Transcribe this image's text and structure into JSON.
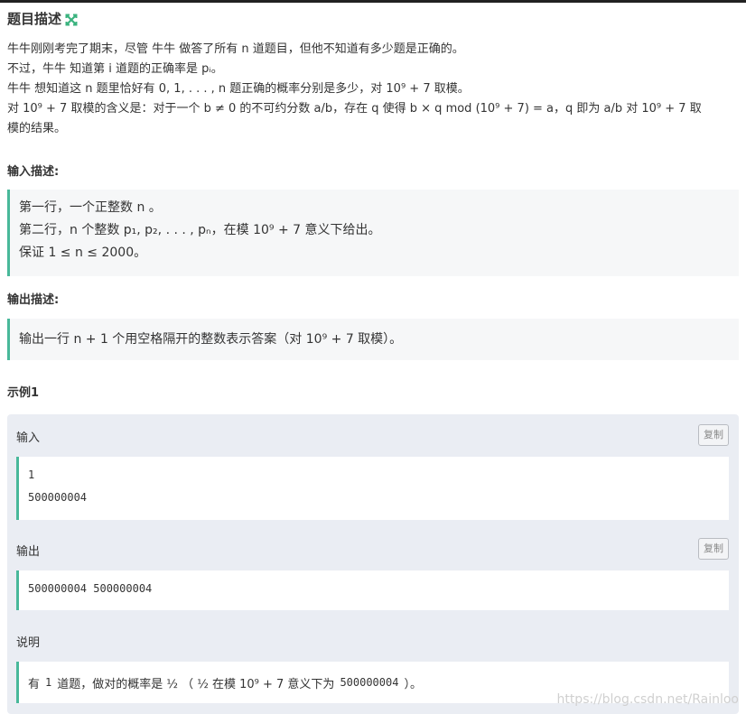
{
  "header": {
    "title": "题目描述",
    "expand_icon": "expand-arrows-icon",
    "accent": "#3bb37f"
  },
  "description": {
    "l1": "牛牛刚刚考完了期末，尽管 牛牛 做答了所有 n 道题目，但他不知道有多少题是正确的。",
    "l2": "不过，牛牛 知道第 i 道题的正确率是 pᵢ。",
    "l3": "牛牛 想知道这 n 题里恰好有 0, 1, . . . , n 题正确的概率分别是多少，对 10⁹ + 7 取模。",
    "l4": "对 10⁹ + 7 取模的含义是：对于一个 b ≠ 0 的不可约分数 a/b，存在 q 使得 b × q mod (10⁹ + 7) = a，q 即为 a/b 对 10⁹ + 7 取",
    "l5": "模的结果。"
  },
  "input_section": {
    "heading": "输入描述:",
    "l1": "第一行，一个正整数 n 。",
    "l2": "第二行，n 个整数 p₁, p₂, . . . , pₙ，在模 10⁹ + 7 意义下给出。",
    "l3": "保证 1 ≤ n ≤ 2000。"
  },
  "output_section": {
    "heading": "输出描述:",
    "l1": "输出一行 n + 1 个用空格隔开的整数表示答案（对 10⁹ + 7 取模）。"
  },
  "example": {
    "heading": "示例1",
    "input_label": "输入",
    "input_lines": [
      "1",
      "500000004"
    ],
    "output_label": "输出",
    "output_lines": [
      "500000004 500000004"
    ],
    "copy_label": "复制",
    "explain_label": "说明",
    "explain": {
      "t1": "有",
      "m1": "1",
      "t2": "道题，做对的概率是 ½ （ ½ 在模 10⁹ + 7 意义下为",
      "m2": "500000004",
      "t3": "）。"
    }
  },
  "watermark": "https://blog.csdn.net/Rainloo"
}
